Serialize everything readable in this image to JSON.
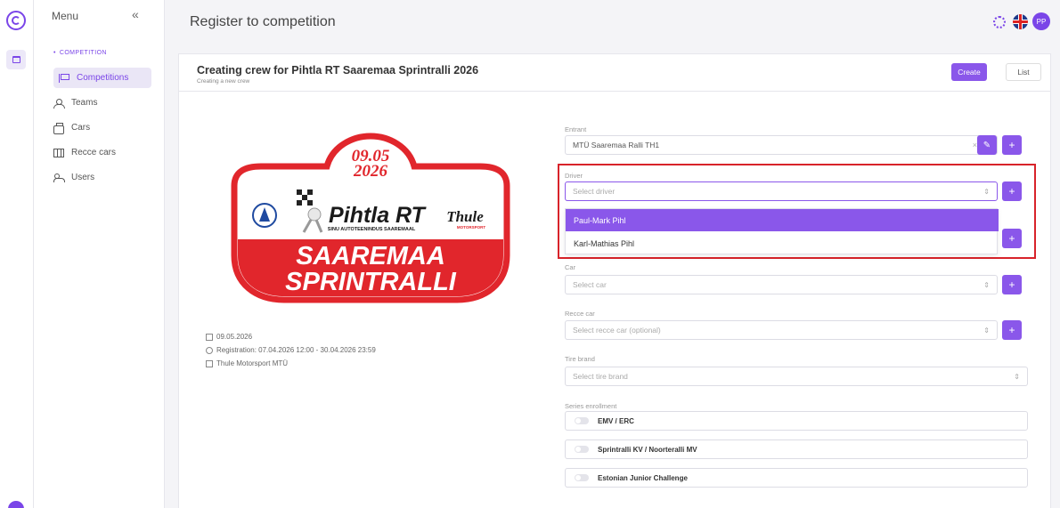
{
  "sidebar": {
    "menu_label": "Menu",
    "collapse_icon": "«",
    "section": "COMPETITION",
    "items": [
      {
        "label": "Competitions",
        "icon": "flag-icon"
      },
      {
        "label": "Teams",
        "icon": "team-icon"
      },
      {
        "label": "Cars",
        "icon": "car-icon"
      },
      {
        "label": "Recce cars",
        "icon": "map-icon"
      },
      {
        "label": "Users",
        "icon": "users-icon"
      }
    ]
  },
  "header": {
    "title": "Register to competition",
    "avatar_initials": "PP"
  },
  "card": {
    "title": "Creating crew for Pihtla RT Saaremaa Sprintralli 2026",
    "subtitle": "Creating a new crew",
    "create_label": "Create",
    "list_label": "List"
  },
  "event": {
    "logo": {
      "date_line1": "09.05",
      "date_line2": "2026",
      "brand": "Pihtla RT",
      "brand_tagline": "SINU AUTOTEENINDUS SAAREMAAL",
      "partner": "Thule",
      "partner_tagline": "MOTORSPORT",
      "name_line1": "SAAREMAA",
      "name_line2": "SPRINTRALLI"
    },
    "date": "09.05.2026",
    "registration": "Registration: 07.04.2026 12:00 - 30.04.2026 23:59",
    "organizer": "Thule Motorsport MTÜ"
  },
  "form": {
    "entrant": {
      "label": "Entrant",
      "value": "MTÜ Saaremaa Ralli TH1"
    },
    "driver": {
      "label": "Driver",
      "placeholder": "Select driver",
      "options": [
        "Paul-Mark Pihl",
        "Karl-Mathias Pihl"
      ]
    },
    "car": {
      "label": "Car",
      "placeholder": "Select car"
    },
    "recce": {
      "label": "Recce car",
      "placeholder": "Select recce car (optional)"
    },
    "tire": {
      "label": "Tire brand",
      "placeholder": "Select tire brand"
    },
    "series": {
      "label": "Series enrollment",
      "items": [
        "EMV / ERC",
        "Sprintralli KV / Noorteralli MV",
        "Estonian Junior Challenge"
      ]
    }
  },
  "colors": {
    "accent": "#8a57ea",
    "highlight": "#d8232a",
    "logo_red": "#e1262c"
  }
}
